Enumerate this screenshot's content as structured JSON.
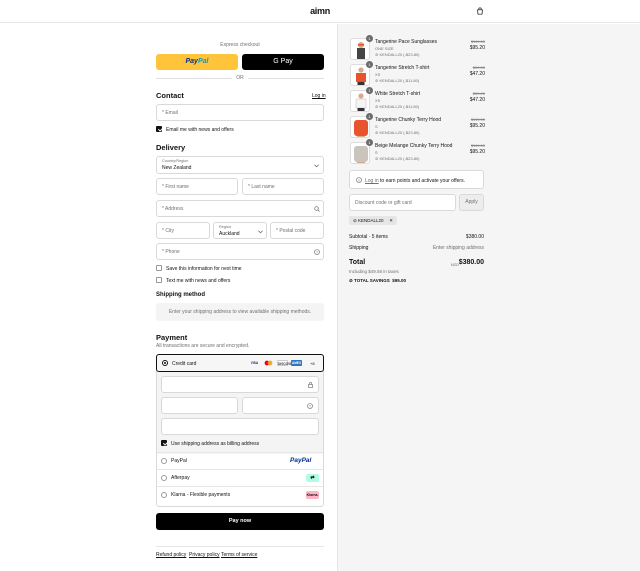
{
  "header": {
    "logo": "aimn"
  },
  "express": {
    "title": "Express checkout",
    "paypal_a": "Pay",
    "paypal_b": "Pal",
    "gpay": "G Pay",
    "or": "OR"
  },
  "contact": {
    "title": "Contact",
    "login": "Log in",
    "email_placeholder": "* Email",
    "news_label": "Email me with news and offers"
  },
  "delivery": {
    "title": "Delivery",
    "country_label": "Country/Region",
    "country_value": "New Zealand",
    "first_name": "* First name",
    "last_name": "* Last name",
    "address": "* Address",
    "city": "* City",
    "region_label": "Region",
    "region_value": "Auckland",
    "postal": "* Postal code",
    "phone": "* Phone",
    "save_info": "Save this information for next time",
    "text_me": "Text me with news and offers"
  },
  "shipping": {
    "title": "Shipping method",
    "message": "Enter your shipping address to view available shipping methods."
  },
  "payment": {
    "title": "Payment",
    "subtitle": "All transactions are secure and encrypted.",
    "credit_card": "Credit card",
    "card_brands": [
      "VISA",
      "MC",
      "DISCOVER",
      "AMEX",
      "+8"
    ],
    "billing_same": "Use shipping address as billing address",
    "methods": [
      {
        "label": "PayPal",
        "badge": "PayPal"
      },
      {
        "label": "Afterpay",
        "badge": "⇄"
      },
      {
        "label": "Klarna - Flexible payments",
        "badge": "Klarna."
      }
    ],
    "pay_now": "Pay now"
  },
  "footer_links": [
    "Refund policy",
    "Privacy policy",
    "Terms of service"
  ],
  "order": {
    "items": [
      {
        "qty": "1",
        "name": "Tangerine Pace Sunglasses",
        "variant": "ONE SIZE",
        "discount": "KENDALL20 (-$23.80)",
        "old_price": "$119.00",
        "price": "$95.20",
        "color": "#e8552d"
      },
      {
        "qty": "1",
        "name": "Tangerine Stretch T-shirt",
        "variant": "XS",
        "discount": "KENDALL20 (-$11.80)",
        "old_price": "$59.00",
        "price": "$47.20",
        "color": "#e8552d"
      },
      {
        "qty": "1",
        "name": "White Stretch T-shirt",
        "variant": "XS",
        "discount": "KENDALL20 (-$11.80)",
        "old_price": "$59.00",
        "price": "$47.20",
        "color": "#e9e9e9"
      },
      {
        "qty": "1",
        "name": "Tangerine Chunky Terry Hood",
        "variant": "S",
        "discount": "KENDALL20 (-$23.80)",
        "old_price": "$119.00",
        "price": "$95.20",
        "color": "#e8552d"
      },
      {
        "qty": "1",
        "name": "Beige Melange Chunky Terry Hood",
        "variant": "S",
        "discount": "KENDALL20 (-$23.80)",
        "old_price": "$119.00",
        "price": "$95.20",
        "color": "#c9c4bc"
      }
    ],
    "points_login": "Log in",
    "points_text": "to earn points and activate your offers.",
    "discount_placeholder": "Discount code or gift card",
    "apply": "Apply",
    "applied_code": "KENDALL20",
    "subtotal_label": "Subtotal · 5 items",
    "subtotal_value": "$380.00",
    "shipping_label": "Shipping",
    "shipping_value": "Enter shipping address",
    "total_label": "Total",
    "currency": "NZD",
    "total_value": "$380.00",
    "taxes": "Including $49.58 in taxes",
    "savings_label": "TOTAL SAVINGS",
    "savings_value": "$95.00"
  }
}
